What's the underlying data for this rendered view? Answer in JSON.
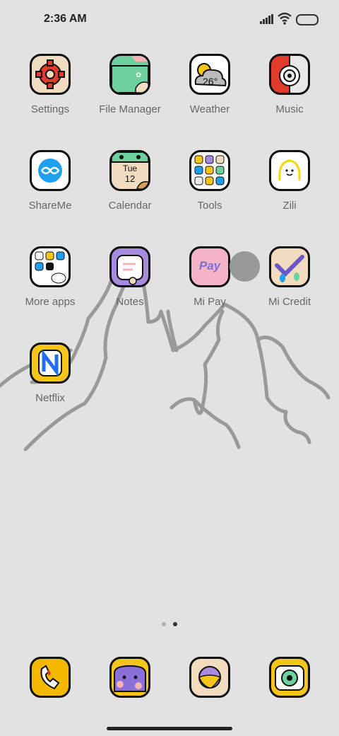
{
  "status_bar": {
    "time": "2:36 AM"
  },
  "apps": [
    {
      "name": "settings",
      "label": "Settings"
    },
    {
      "name": "file-manager",
      "label": "File Manager"
    },
    {
      "name": "weather",
      "label": "Weather",
      "temp": "26°"
    },
    {
      "name": "music",
      "label": "Music"
    },
    {
      "name": "shareme",
      "label": "ShareMe"
    },
    {
      "name": "calendar",
      "label": "Calendar",
      "day": "Tue",
      "date": "12"
    },
    {
      "name": "tools",
      "label": "Tools"
    },
    {
      "name": "zili",
      "label": "Zili"
    },
    {
      "name": "more-apps",
      "label": "More apps"
    },
    {
      "name": "notes",
      "label": "Notes"
    },
    {
      "name": "mi-pay",
      "label": "Mi Pay",
      "logo": "Pay"
    },
    {
      "name": "mi-credit",
      "label": "Mi Credit"
    },
    {
      "name": "netflix",
      "label": "Netflix"
    }
  ],
  "page_indicator": {
    "count": 2,
    "active": 2
  },
  "dock": [
    {
      "name": "phone-icon"
    },
    {
      "name": "messages-icon"
    },
    {
      "name": "browser-icon"
    },
    {
      "name": "camera-icon"
    }
  ]
}
